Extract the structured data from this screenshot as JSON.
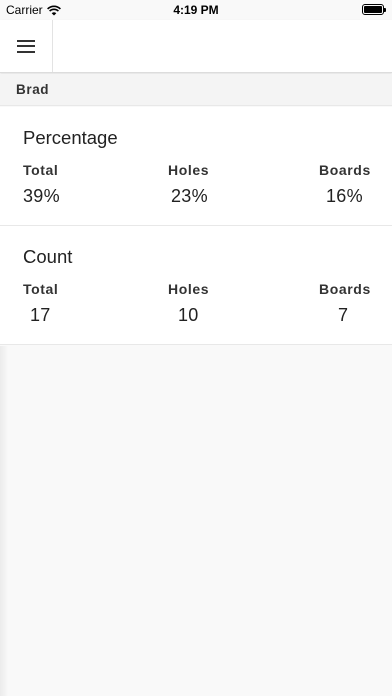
{
  "status_bar": {
    "carrier": "Carrier",
    "time": "4:19 PM"
  },
  "header": {
    "menu_icon": "hamburger-menu-icon"
  },
  "subheader": {
    "name": "Brad"
  },
  "cards": [
    {
      "title": "Percentage",
      "columns": [
        {
          "label": "Total",
          "value": "39%"
        },
        {
          "label": "Holes",
          "value": "23%"
        },
        {
          "label": "Boards",
          "value": "16%"
        }
      ]
    },
    {
      "title": "Count",
      "columns": [
        {
          "label": "Total",
          "value": "17"
        },
        {
          "label": "Holes",
          "value": "10"
        },
        {
          "label": "Boards",
          "value": "7"
        }
      ]
    }
  ]
}
